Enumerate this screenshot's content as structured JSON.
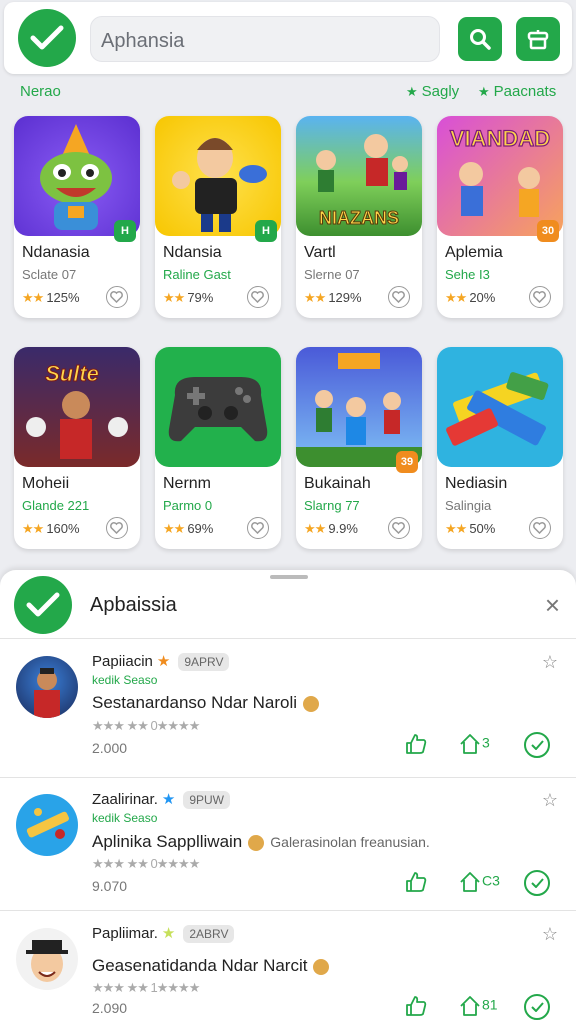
{
  "header": {
    "search_placeholder": "Aphansia"
  },
  "filters": {
    "section_label": "Nerao",
    "filter1": "Sagly",
    "filter2": "Paacnats"
  },
  "cards": [
    {
      "name": "Ndanasia",
      "sub": "Sclate 07",
      "rating": "125%",
      "badge": "H",
      "badge_color": "#23a84a"
    },
    {
      "name": "Ndansia",
      "sub": "Raline Gast",
      "rating": "79%",
      "badge": "H",
      "badge_color": "#23a84a"
    },
    {
      "name": "Vartl",
      "sub": "Slerne 07",
      "rating": "129%",
      "thumb_text": "NIAZANS"
    },
    {
      "name": "Aplemia",
      "sub": "Sehe I3",
      "rating": "20%",
      "badge": "30",
      "badge_color": "#f08c1e",
      "thumb_text": "VIANDAD"
    },
    {
      "name": "Moheii",
      "sub": "Glande 221",
      "rating": "160%",
      "thumb_text": "Sulte"
    },
    {
      "name": "Nernm",
      "sub": "Parmo 0",
      "rating": "69%"
    },
    {
      "name": "Bukainah",
      "sub": "Slarng 77",
      "rating": "9.9%",
      "badge": "39",
      "badge_color": "#f08c1e"
    },
    {
      "name": "Nediasin",
      "sub": "Salingia",
      "rating": "50%"
    }
  ],
  "sheet": {
    "title": "Apbaissia",
    "close": "×"
  },
  "items": [
    {
      "name": "Papiiacin",
      "tag": "9APRV",
      "sub": "kedik Seaso",
      "desc": "Sestanardanso Ndar Naroli",
      "extra": "",
      "stars": "★★★ ★★ 0★★★★",
      "count": "2.000",
      "act_label": "3",
      "star_color": "#f08c1e"
    },
    {
      "name": "Zaalirinar.",
      "tag": "9PUW",
      "sub": "kedik Seaso",
      "desc": "Aplinika Sapplliwain",
      "extra": "Galerasinolan freanusian.",
      "stars": "★★★ ★★ 0★★★★",
      "count": "9.070",
      "act_label": "C3",
      "star_color": "#2196f3"
    },
    {
      "name": "Papliimar.",
      "tag": "2ABRV",
      "sub": "",
      "desc": "Geasenatidanda Ndar Narcit",
      "extra": "",
      "stars": "★★★ ★★ 1★★★★",
      "count": "2.090",
      "act_label": "81",
      "star_color": "#c6e05a"
    }
  ]
}
